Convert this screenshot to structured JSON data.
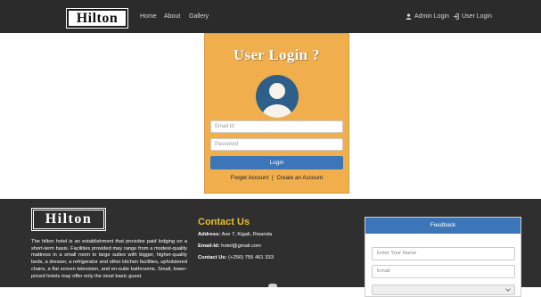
{
  "navbar": {
    "brand": "Hilton",
    "links": [
      "Home",
      "About",
      "Gallery"
    ],
    "admin_login": "Admin Login",
    "user_login": "User Login"
  },
  "login": {
    "title": "User Login ?",
    "email_placeholder": "Email Id",
    "password_placeholder": "Password",
    "button": "Login",
    "forget_account": "Forget Account",
    "separator": "|",
    "create_account": "Create an Account"
  },
  "footer": {
    "brand": "Hilton",
    "about": "The hilton hotel is an establishment that provides paid lodging on a short-term basis. Facilities provided may range from a modest-quality mattress in a small room to large suites with bigger, higher-quality beds, a dresser, a refrigerator and other kitchen facilities, upholstered chairs, a flat screen television, and en-suite bathrooms. Small, lower-priced hotels may offer only the most basic guest",
    "contact": {
      "title": "Contact Us",
      "address_label": "Address:",
      "address": "Ave 7, Kigali, Rwanda",
      "email_label": "Email-Id:",
      "email": "hotel@gmail.com",
      "phone_label": "Contact Us:",
      "phone": "(+250) 755 461 333"
    },
    "feedback": {
      "title": "Feedback",
      "name_placeholder": "Enter Your Name",
      "email_placeholder": "Email"
    }
  },
  "colors": {
    "navbar_bg": "#2b2b2b",
    "card_bg": "#f0ae4c",
    "primary": "#3c76b8",
    "footer_bg": "#2f2f2f",
    "contact_title": "#e6c02a"
  },
  "icons": {
    "admin": "user-icon",
    "user_login": "sign-in-icon",
    "avatar": "avatar-icon"
  }
}
